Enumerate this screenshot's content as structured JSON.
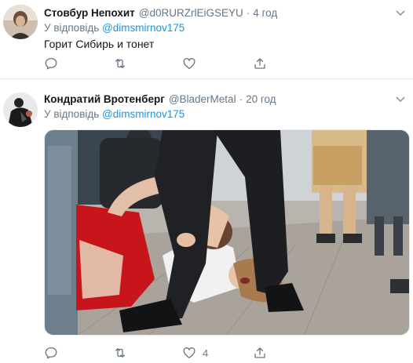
{
  "tweets": [
    {
      "name": "Стовбур Непохит",
      "handle": "@d0RURZrlEiGSEYU",
      "dot": "·",
      "time": "4 год",
      "reply_prefix": "У відповідь",
      "reply_mention": "@dimsmirnov175",
      "text": "Горит Сибирь и тонет",
      "actions": {
        "reply_count": "",
        "retweet_count": "",
        "like_count": ""
      }
    },
    {
      "name": "Кондратий Вротенберг",
      "handle": "@BladerMetal",
      "dot": "·",
      "time": "20 год",
      "reply_prefix": "У відповідь",
      "reply_mention": "@dimsmirnov175",
      "text": "",
      "media": "photo",
      "actions": {
        "reply_count": "",
        "retweet_count": "",
        "like_count": "4"
      }
    }
  ],
  "icons": [
    "reply-icon",
    "retweet-icon",
    "like-icon",
    "share-icon",
    "chevron-down-icon"
  ],
  "colors": {
    "text": "#14171a",
    "secondary": "#657786",
    "link": "#1b95e0",
    "divider": "#e6ecf0"
  }
}
